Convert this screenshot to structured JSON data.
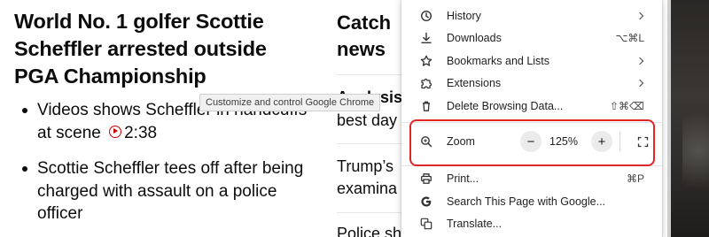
{
  "article": {
    "headline": "World No. 1 golfer Scottie Scheffler arrested outside PGA Championship",
    "bullets": [
      {
        "text": "Videos shows Scheffler in handcuffs at scene",
        "duration": "2:38"
      },
      {
        "text": "Scottie Scheffler tees off after being charged with assault on a police officer"
      }
    ]
  },
  "sidebar_column": {
    "title": "Catch news",
    "items": [
      {
        "bold": "Analysis",
        "text": "best day"
      },
      {
        "text": "Trump’s examina"
      },
      {
        "text": "Police sh"
      }
    ]
  },
  "tooltip": "Customize and control Google Chrome",
  "menu": {
    "items": [
      {
        "label": "History",
        "icon": "history-icon",
        "submenu": true
      },
      {
        "label": "Downloads",
        "icon": "download-icon",
        "shortcut": "⌥⌘L"
      },
      {
        "label": "Bookmarks and Lists",
        "icon": "star-icon",
        "submenu": true
      },
      {
        "label": "Extensions",
        "icon": "extension-puzzle-icon",
        "submenu": true
      },
      {
        "label": "Delete Browsing Data...",
        "icon": "trash-icon",
        "shortcut": "⇧⌘⌫"
      }
    ],
    "zoom": {
      "label": "Zoom",
      "value": "125%",
      "minus": "−",
      "plus": "+"
    },
    "bottom_items": [
      {
        "label": "Print...",
        "icon": "printer-icon",
        "shortcut": "⌘P"
      },
      {
        "label": "Search This Page with Google...",
        "icon": "google-g-icon"
      },
      {
        "label": "Translate...",
        "icon": "translate-icon"
      }
    ],
    "highlight_color": "#e02525"
  }
}
